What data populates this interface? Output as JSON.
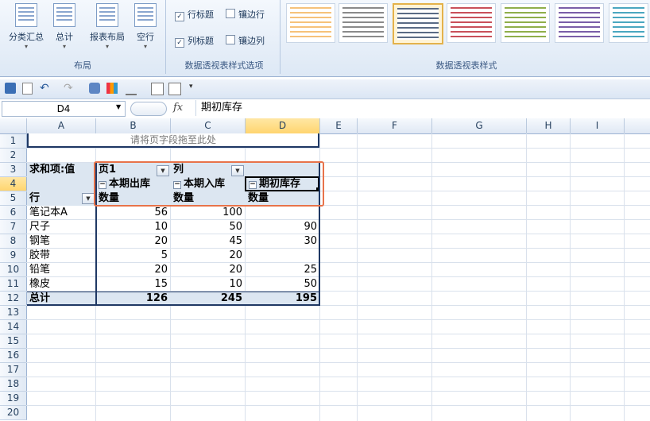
{
  "ribbon": {
    "layout_group": {
      "label": "布局",
      "buttons": [
        "分类汇总",
        "总计",
        "报表布局",
        "空行"
      ]
    },
    "options_group": {
      "label": "数据透视表样式选项",
      "row_headers": "行标题",
      "col_headers": "列标题",
      "banded_rows": "镶边行",
      "banded_cols": "镶边列",
      "row_headers_checked": true,
      "col_headers_checked": true
    },
    "styles_group": {
      "label": "数据透视表样式"
    }
  },
  "formula_bar": {
    "name_box": "D4",
    "fx": "fx",
    "content": "期初库存"
  },
  "columns": [
    "A",
    "B",
    "C",
    "D",
    "E",
    "F",
    "G",
    "H",
    "I"
  ],
  "rows": [
    "1",
    "2",
    "3",
    "4",
    "5",
    "6",
    "7",
    "8",
    "9",
    "10",
    "11",
    "12",
    "13",
    "14",
    "15",
    "16",
    "17",
    "18",
    "19",
    "20"
  ],
  "pivot": {
    "page_drop_hint": "请将页字段拖至此处",
    "data_label": "求和项:值",
    "page_field": "页1",
    "col_field": "列",
    "row_field": "行",
    "col_headers": [
      "本期出库",
      "本期入库",
      "期初库存"
    ],
    "measure": "数量",
    "rows": [
      {
        "name": "笔记本A",
        "b": "56",
        "c": "100",
        "d": ""
      },
      {
        "name": "尺子",
        "b": "10",
        "c": "50",
        "d": "90"
      },
      {
        "name": "钢笔",
        "b": "20",
        "c": "45",
        "d": "30"
      },
      {
        "name": "胶带",
        "b": "5",
        "c": "20",
        "d": ""
      },
      {
        "name": "铅笔",
        "b": "20",
        "c": "20",
        "d": "25"
      },
      {
        "name": "橡皮",
        "b": "15",
        "c": "10",
        "d": "50"
      }
    ],
    "total": {
      "name": "总计",
      "b": "126",
      "c": "245",
      "d": "195"
    }
  },
  "colors": {
    "highlight_border": "#e8734a",
    "pivot_header_fill": "#dce6f1",
    "active_header": "#ffd56f"
  }
}
